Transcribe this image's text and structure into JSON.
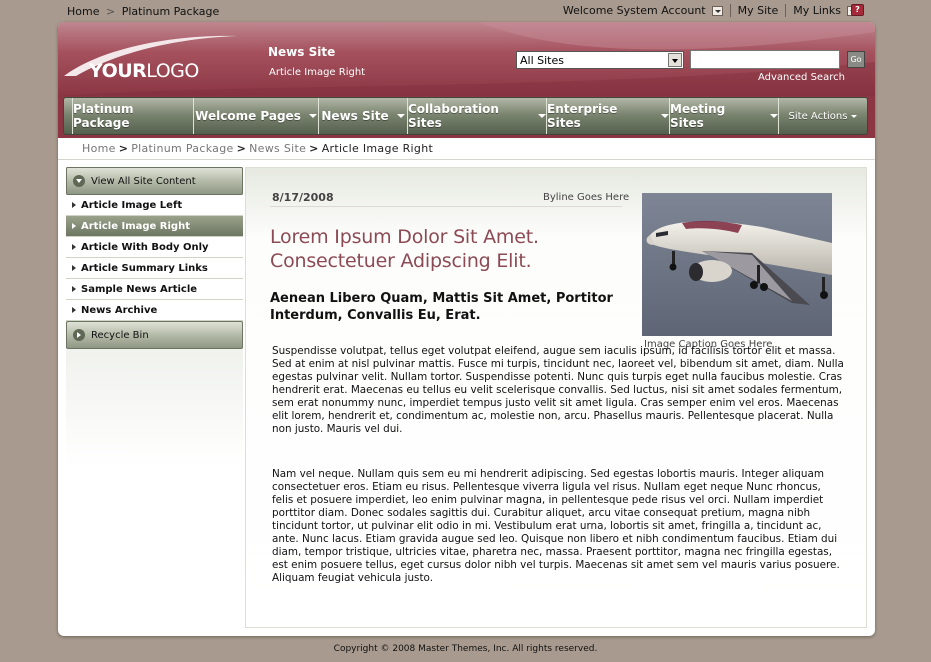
{
  "topbar": {
    "breadcrumb": [
      "Home",
      "Platinum Package"
    ],
    "breadcrumb_sep": ">",
    "welcome": "Welcome System Account",
    "my_site": "My Site",
    "my_links": "My Links",
    "help_glyph": "?"
  },
  "header": {
    "logo_bold": "YOUR",
    "logo_light": "LOGO",
    "site_title": "News Site",
    "site_subtitle": "Article Image Right",
    "search_scope": "All Sites",
    "search_placeholder": "",
    "go_label": "Go",
    "advanced_search": "Advanced Search"
  },
  "nav": {
    "items": [
      {
        "label": "Platinum Package",
        "dropdown": false
      },
      {
        "label": "Welcome Pages",
        "dropdown": true
      },
      {
        "label": "News Site",
        "dropdown": true
      },
      {
        "label": "Collaboration Sites",
        "dropdown": true
      },
      {
        "label": "Enterprise Sites",
        "dropdown": true
      },
      {
        "label": "Meeting Sites",
        "dropdown": true
      }
    ],
    "site_actions": "Site Actions"
  },
  "breadcrumb": {
    "items": [
      "Home",
      "Platinum Package",
      "News Site"
    ],
    "current": "Article Image Right",
    "sep": ">"
  },
  "sidebar": {
    "view_all": "View All Site Content",
    "items": [
      {
        "label": "Article Image Left",
        "active": false
      },
      {
        "label": "Article Image Right",
        "active": true
      },
      {
        "label": "Article With Body Only",
        "active": false
      },
      {
        "label": "Article Summary Links",
        "active": false
      },
      {
        "label": "Sample News Article",
        "active": false
      },
      {
        "label": "News Archive",
        "active": false
      }
    ],
    "recycle_bin": "Recycle Bin"
  },
  "article": {
    "date": "8/17/2008",
    "byline": "Byline Goes Here",
    "headline": "Lorem Ipsum Dolor Sit Amet. Consectetuer Adipscing Elit.",
    "subhead": "Aenean Libero Quam, Mattis Sit Amet, Portitor Interdum, Convallis Eu, Erat.",
    "image_caption": "Image Caption Goes Here",
    "image_alt": "airplane-photo",
    "body_1": "Suspendisse volutpat, tellus eget volutpat eleifend, augue sem iaculis ipsum, id facilisis tortor elit et massa. Sed at enim at nisl pulvinar mattis. Fusce mi turpis, tincidunt nec, laoreet vel, bibendum sit amet, diam. Nulla egestas pulvinar velit. Nullam tortor. Suspendisse potenti. Nunc quis turpis eget nulla faucibus molestie. Cras hendrerit erat. Maecenas eu tellus eu velit scelerisque convallis. Sed luctus, nisi sit amet sodales fermentum, sem erat nonummy nunc, imperdiet tempus justo velit sit amet ligula. Cras semper enim vel eros. Maecenas elit lorem, hendrerit et, condimentum ac, molestie non, arcu. Phasellus mauris. Pellentesque placerat. Nulla non justo. Mauris vel dui.",
    "body_2": "Nam vel neque. Nullam quis sem eu mi hendrerit adipiscing. Sed egestas lobortis mauris. Integer aliquam consectetuer eros. Etiam eu risus. Pellentesque viverra ligula vel risus. Nullam eget neque Nunc rhoncus, felis et posuere imperdiet, leo enim pulvinar magna, in pellentesque pede risus vel orci. Nullam imperdiet porttitor diam. Donec sodales sagittis dui. Curabitur aliquet, arcu vitae consequat pretium, magna nibh tincidunt tortor, ut pulvinar elit odio in mi. Vestibulum erat urna, lobortis sit amet, fringilla a, tincidunt ac, ante. Nunc lacus. Etiam gravida augue sed leo. Quisque non libero et nibh condimentum faucibus. Etiam dui diam, tempor tristique, ultricies vitae, pharetra nec, massa. Praesent porttitor, magna nec fringilla egestas, est enim posuere tellus, eget cursus dolor nibh vel turpis. Maecenas sit amet sem vel mauris varius posuere. Aliquam feugiat vehicula justo."
  },
  "footer": {
    "copyright": "Copyright © 2008 Master Themes, Inc. All rights reserved."
  },
  "colors": {
    "background": "#a89a8e",
    "header_red": "#a5525e",
    "nav_green": "#7b8570",
    "headline": "#8c4a54"
  }
}
